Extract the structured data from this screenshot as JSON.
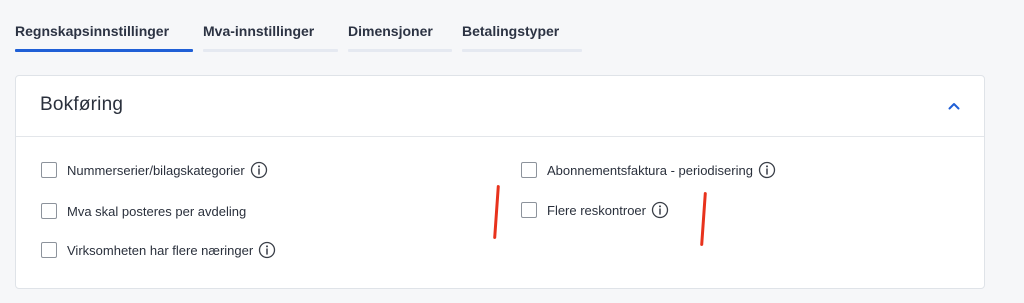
{
  "tabs": [
    {
      "label": "Regnskapsinnstillinger",
      "active": true
    },
    {
      "label": "Mva-innstillinger",
      "active": false
    },
    {
      "label": "Dimensjoner",
      "active": false
    },
    {
      "label": "Betalingstyper",
      "active": false
    }
  ],
  "section": {
    "title": "Bokføring",
    "expanded": true,
    "collapse_icon": "chevron-up-icon"
  },
  "options": {
    "left": [
      {
        "label": "Nummerserier/bilagskategorier",
        "checked": false,
        "info_icon": true
      },
      {
        "label": "Mva skal posteres per avdeling",
        "checked": false,
        "info_icon": false
      },
      {
        "label": "Virksomheten har flere næringer",
        "checked": false,
        "info_icon": true
      }
    ],
    "right": [
      {
        "label": "Abonnementsfaktura - periodisering",
        "checked": false,
        "info_icon": true
      },
      {
        "label": "Flere reskontroer",
        "checked": false,
        "info_icon": true
      }
    ]
  },
  "colors": {
    "accent": "#1f5fd6",
    "annotation": "#e8321c",
    "background": "#f6f7f9"
  }
}
